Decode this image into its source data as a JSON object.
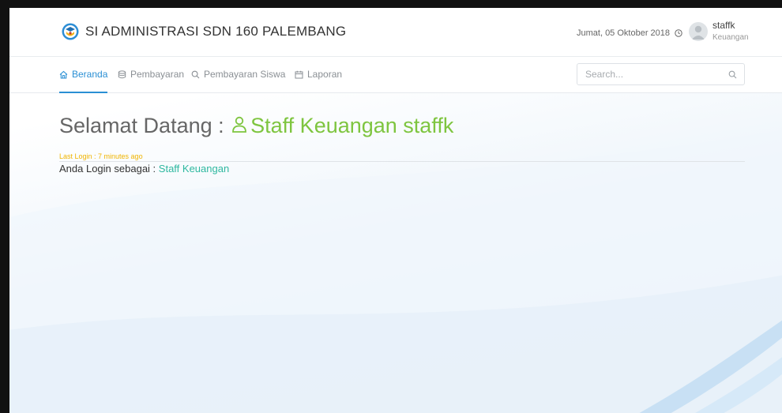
{
  "header": {
    "title": "SI ADMINISTRASI SDN 160 PALEMBANG",
    "datetime": "Jumat, 05 Oktober 2018",
    "user": {
      "name": "staffk",
      "role": "Keuangan"
    }
  },
  "nav": {
    "items": [
      {
        "label": "Beranda",
        "icon": "home-icon",
        "active": true
      },
      {
        "label": "Pembayaran",
        "icon": "database-icon",
        "active": false
      },
      {
        "label": "Pembayaran Siswa",
        "icon": "search-icon",
        "active": false
      },
      {
        "label": "Laporan",
        "icon": "calendar-icon",
        "active": false
      }
    ],
    "search": {
      "placeholder": "Search...",
      "value": ""
    }
  },
  "content": {
    "welcome_prefix": "Selamat Datang :",
    "welcome_user": "Staff Keuangan staffk",
    "last_login": "Last Login : 7 minutes ago",
    "role_prefix": "Anda Login sebagai :",
    "role_value": "Staff Keuangan"
  },
  "colors": {
    "accent_blue": "#2a8fd4",
    "green": "#7ec53f",
    "teal": "#2fb8a0",
    "warning": "#f0b400"
  }
}
